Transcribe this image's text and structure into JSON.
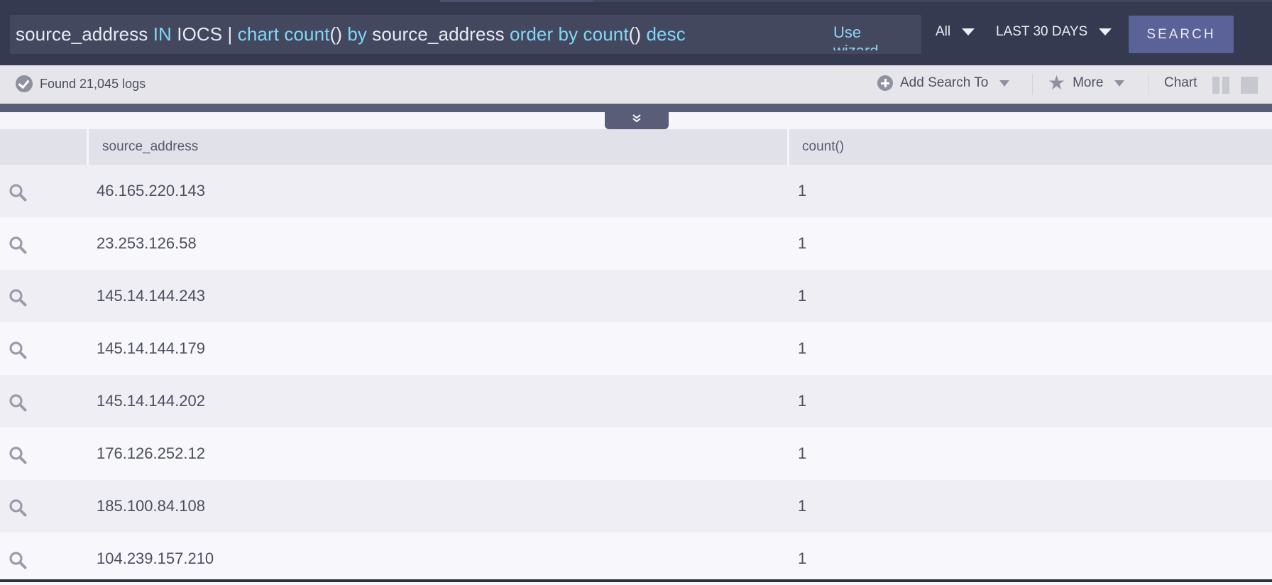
{
  "query_bar": {
    "query": {
      "tokens": [
        {
          "text": "source_address ",
          "kind": "plain"
        },
        {
          "text": "IN",
          "kind": "kw"
        },
        {
          "text": " IOCS | ",
          "kind": "plain"
        },
        {
          "text": "chart count",
          "kind": "kw"
        },
        {
          "text": "() ",
          "kind": "plain"
        },
        {
          "text": "by",
          "kind": "kw"
        },
        {
          "text": " source_address ",
          "kind": "plain"
        },
        {
          "text": "order by count",
          "kind": "kw"
        },
        {
          "text": "() ",
          "kind": "plain"
        },
        {
          "text": "desc",
          "kind": "kw"
        }
      ]
    },
    "use_wizard_label": "Use wizard",
    "scope_select": "All",
    "time_range_select": "LAST 30 DAYS",
    "search_button_label": "SEARCH"
  },
  "toolbar": {
    "found_text": "Found 21,045 logs",
    "add_search_to_label": "Add Search To",
    "more_label": "More",
    "chart_label": "Chart"
  },
  "table": {
    "columns": [
      "source_address",
      "count()"
    ],
    "rows": [
      {
        "source_address": "46.165.220.143",
        "count": "1"
      },
      {
        "source_address": "23.253.126.58",
        "count": "1"
      },
      {
        "source_address": "145.14.144.243",
        "count": "1"
      },
      {
        "source_address": "145.14.144.179",
        "count": "1"
      },
      {
        "source_address": "145.14.144.202",
        "count": "1"
      },
      {
        "source_address": "176.126.252.12",
        "count": "1"
      },
      {
        "source_address": "185.100.84.108",
        "count": "1"
      },
      {
        "source_address": "104.239.157.210",
        "count": "1"
      }
    ]
  },
  "colors": {
    "topbar_bg": "#363a50",
    "query_keyword": "#80d8f6",
    "search_button_bg": "#5b6297",
    "divider_strip": "#5a5d78"
  },
  "icons": {
    "found_status": "check-circle-icon",
    "add_search": "plus-circle-icon",
    "more": "star-icon",
    "collapse": "double-chevron-down-icon",
    "row_action": "magnifier-icon",
    "layout_split": "split-layout-icon",
    "layout_single": "single-layout-icon"
  }
}
